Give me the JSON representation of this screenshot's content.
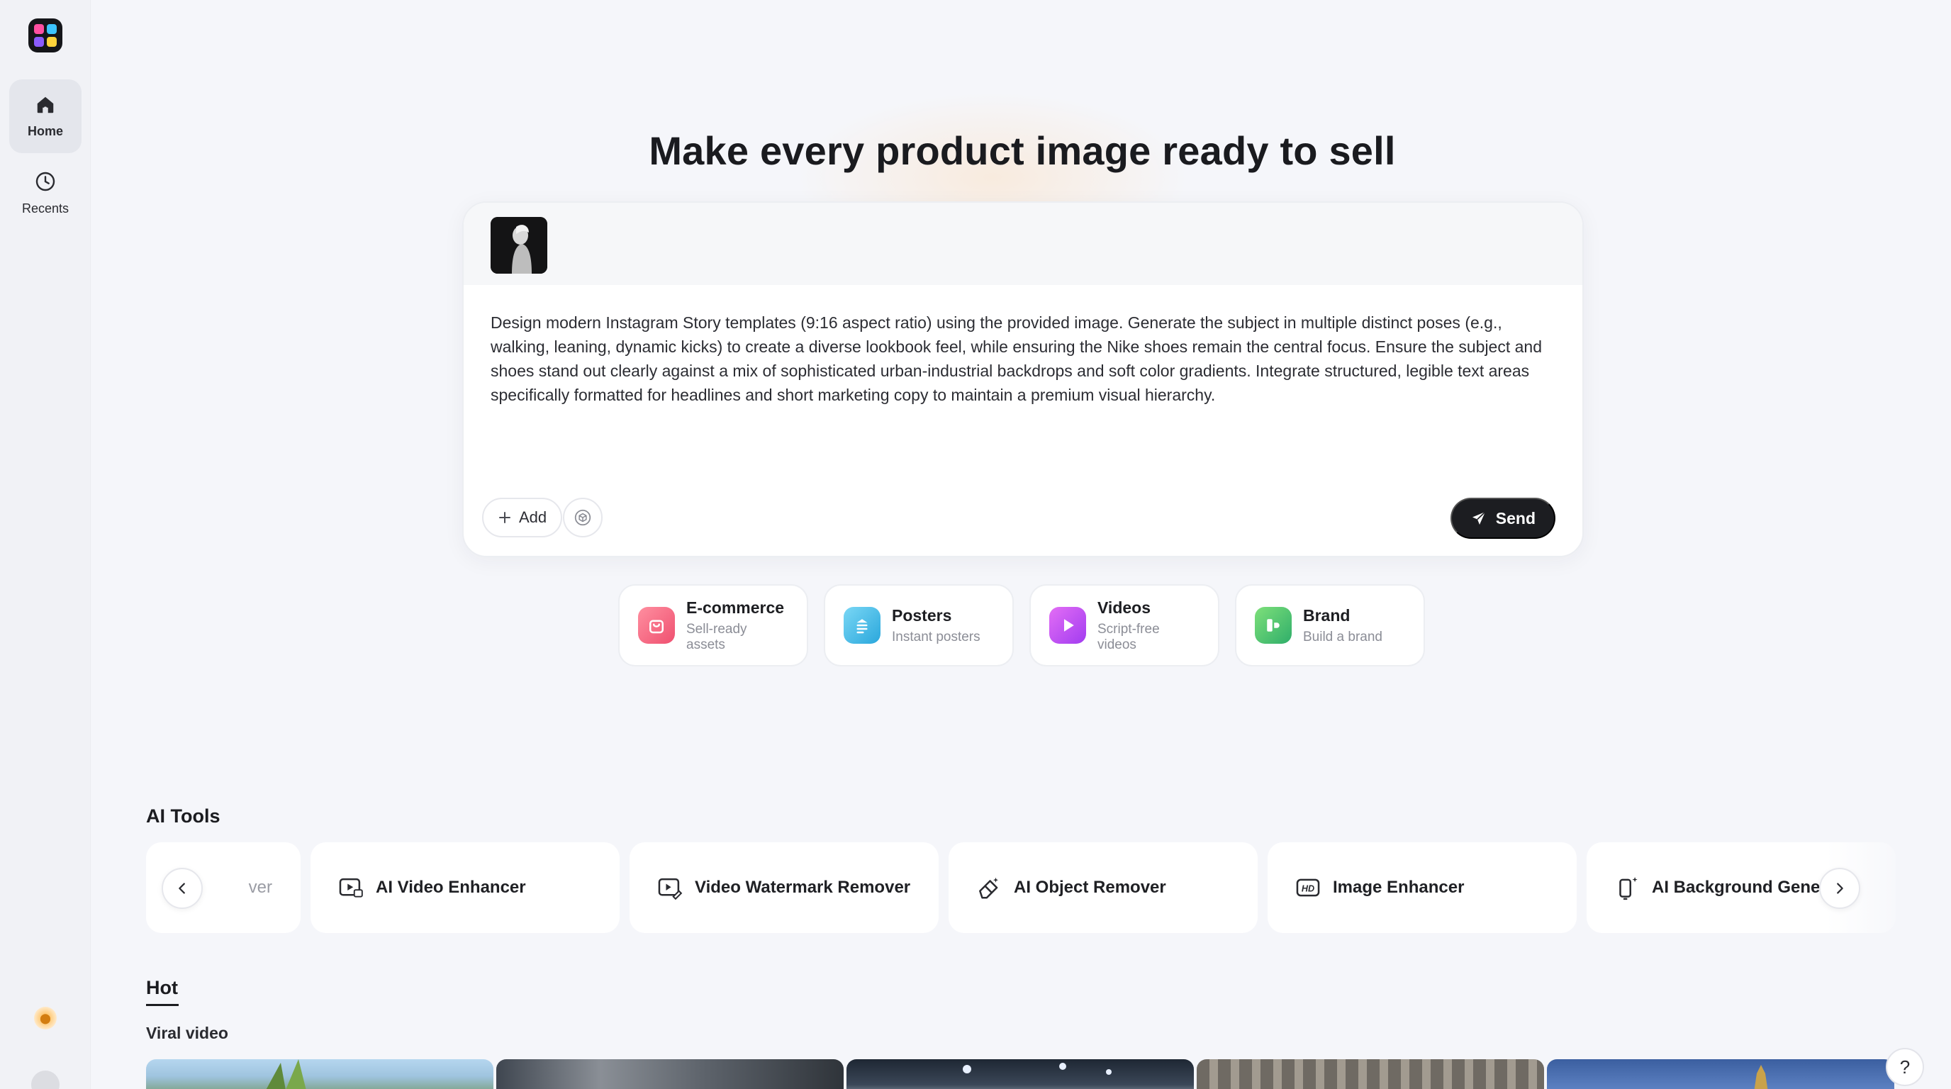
{
  "sidebar": {
    "logo": "app-logo",
    "items": [
      {
        "label": "Home",
        "icon": "home-icon",
        "active": true
      },
      {
        "label": "Recents",
        "icon": "clock-icon",
        "active": false
      }
    ]
  },
  "hero": {
    "headline": "Make every product image ready to sell"
  },
  "prompt": {
    "text": "Design modern Instagram Story templates (9:16 aspect ratio) using the provided image. Generate the subject in multiple distinct poses (e.g., walking, leaning, dynamic kicks) to create a diverse lookbook feel, while ensuring the Nike shoes remain the central focus. Ensure the subject and shoes stand out clearly against a mix of sophisticated urban-industrial backdrops and soft color gradients. Integrate structured, legible text areas specifically formatted for headlines and short marketing copy to maintain a premium visual hierarchy.",
    "add_label": "Add",
    "send_label": "Send"
  },
  "categories": [
    {
      "title": "E-commerce",
      "subtitle": "Sell-ready assets",
      "icon": "shopping-bag-icon",
      "color": "#f0607e"
    },
    {
      "title": "Posters",
      "subtitle": "Instant posters",
      "icon": "poster-icon",
      "color": "#3bb4e6"
    },
    {
      "title": "Videos",
      "subtitle": "Script-free videos",
      "icon": "play-icon",
      "color": "#c04cf0"
    },
    {
      "title": "Brand",
      "subtitle": "Build a brand",
      "icon": "brand-icon",
      "color": "#3ec47a"
    }
  ],
  "ai_tools": {
    "title": "AI Tools",
    "partial_label": "ver",
    "items": [
      {
        "label": "AI Video Enhancer",
        "icon": "video-hd-icon"
      },
      {
        "label": "Video Watermark Remover",
        "icon": "video-eraser-icon"
      },
      {
        "label": "AI Object Remover",
        "icon": "eraser-icon"
      },
      {
        "label": "Image Enhancer",
        "icon": "hd-icon"
      },
      {
        "label": "AI Background Gener",
        "icon": "phone-sparkle-icon"
      }
    ]
  },
  "hot": {
    "tab_label": "Hot",
    "section_title": "Viral video"
  },
  "help_label": "?"
}
